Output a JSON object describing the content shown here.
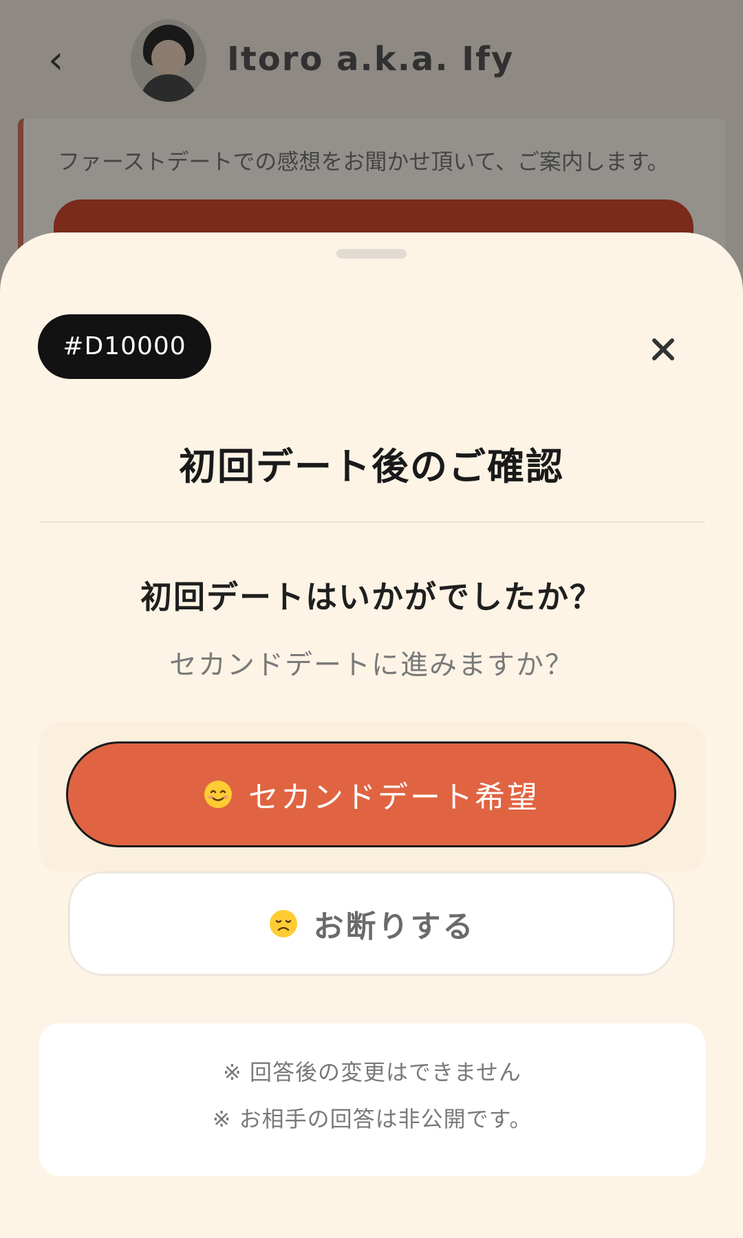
{
  "background_page": {
    "back_glyph": "‹",
    "user_name": "Itoro a.k.a. Ify",
    "card_text": "ファーストデートでの感想をお聞かせ頂いて、ご案内します。"
  },
  "sheet": {
    "tag": "#D10000",
    "close_label": "×",
    "title": "初回デート後のご確認",
    "question": "初回デートはいかがでしたか？",
    "subquestion": "セカンドデートに進みますか？",
    "primary_button": {
      "label": "セカンドデート希望",
      "emoji": "smiling-face-icon"
    },
    "secondary_button": {
      "label": "お断りする",
      "emoji": "disappointed-face-icon"
    },
    "notes": [
      "※ 回答後の変更はできません",
      "※ お相手の回答は非公開です。"
    ]
  },
  "colors": {
    "sheet_bg": "#fdf4e6",
    "primary": "#e06442",
    "tag_bg": "#121212"
  }
}
